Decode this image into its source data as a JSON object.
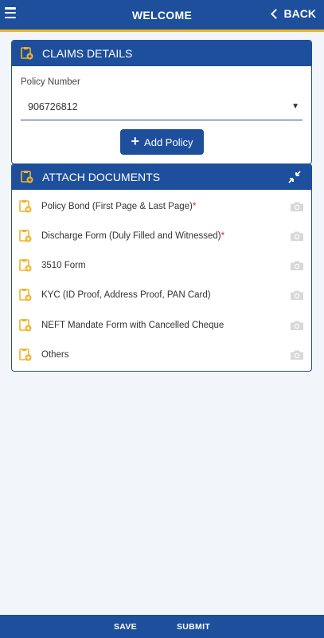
{
  "header": {
    "title": "WELCOME",
    "back_label": "BACK"
  },
  "claims": {
    "title": "CLAIMS DETAILS",
    "policy_label": "Policy Number",
    "policy_value": "906726812",
    "add_policy_label": "Add Policy"
  },
  "attach": {
    "title": "ATTACH DOCUMENTS",
    "items": [
      {
        "label": "Policy Bond (First Page & Last Page)",
        "required": "*"
      },
      {
        "label": "Discharge Form (Duly Filled and Witnessed)",
        "required": "*"
      },
      {
        "label": "3510 Form",
        "required": ""
      },
      {
        "label": "KYC (ID Proof, Address Proof, PAN Card)",
        "required": ""
      },
      {
        "label": "NEFT Mandate Form with Cancelled Cheque",
        "required": ""
      },
      {
        "label": "Others",
        "required": ""
      }
    ]
  },
  "footer": {
    "save_label": "SAVE",
    "submit_label": "SUBMIT"
  },
  "colors": {
    "primary": "#1d4f9c",
    "accent": "#f0b429",
    "required": "#d52b1e"
  },
  "icons": [
    "menu-icon",
    "chevron-left-icon",
    "document-icon",
    "plus-icon",
    "collapse-icon",
    "camera-icon"
  ]
}
